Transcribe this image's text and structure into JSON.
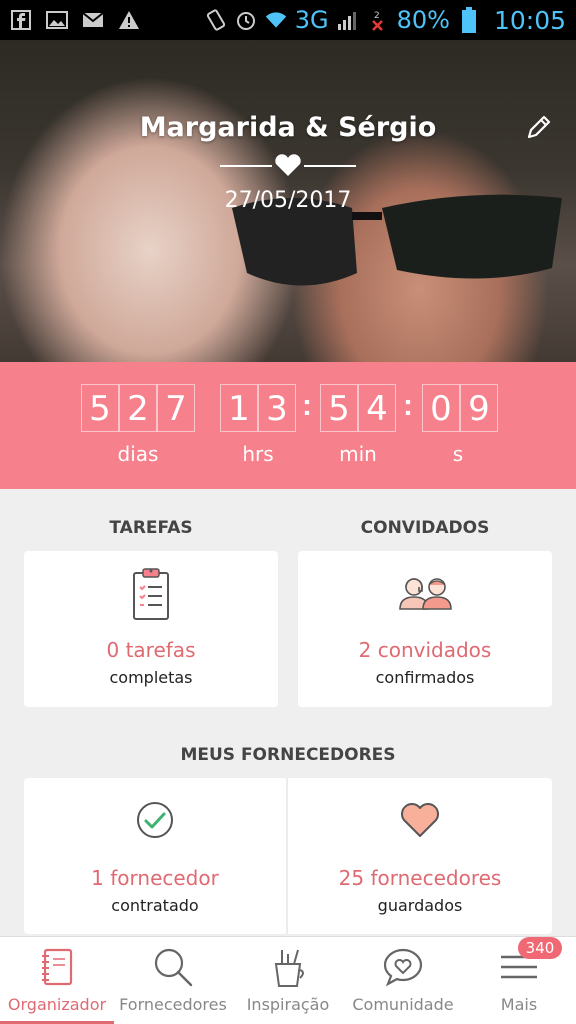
{
  "status_bar": {
    "network": "3G",
    "battery_percent": "80%",
    "time": "10:05"
  },
  "hero": {
    "title": "Margarida & Sérgio",
    "date": "27/05/2017"
  },
  "countdown": {
    "days": [
      "5",
      "2",
      "7"
    ],
    "hours": [
      "1",
      "3"
    ],
    "minutes": [
      "5",
      "4"
    ],
    "seconds": [
      "0",
      "9"
    ],
    "labels": {
      "days": "dias",
      "hours": "hrs",
      "minutes": "min",
      "seconds": "s"
    }
  },
  "tasks": {
    "header": "TAREFAS",
    "count": "0 tarefas",
    "sub": "completas"
  },
  "guests": {
    "header": "CONVIDADOS",
    "count": "2 convidados",
    "sub": "confirmados"
  },
  "vendors": {
    "header": "MEUS FORNECEDORES",
    "hired_count": "1 fornecedor",
    "hired_sub": "contratado",
    "saved_count": "25 fornecedores",
    "saved_sub": "guardados"
  },
  "nav": {
    "items": [
      {
        "label": "Organizador",
        "icon": "notebook-icon",
        "active": true
      },
      {
        "label": "Fornecedores",
        "icon": "search-icon"
      },
      {
        "label": "Inspiração",
        "icon": "pencil-cup-icon"
      },
      {
        "label": "Comunidade",
        "icon": "chat-heart-icon"
      },
      {
        "label": "Mais",
        "icon": "menu-icon"
      }
    ],
    "badge": "340"
  },
  "colors": {
    "accent": "#f6808b",
    "accent_text": "#e06a72",
    "status_icon": "#4fc3f7"
  }
}
